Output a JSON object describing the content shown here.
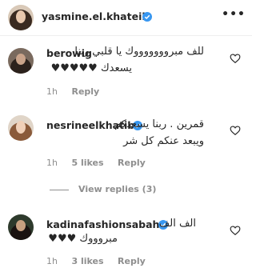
{
  "header": {
    "username": "yasmine.el.khateib",
    "verified": true
  },
  "comments": [
    {
      "username": "berowig",
      "verified": false,
      "text_line1": "للف مبروووووووك يا قلبي ربنا",
      "text_line2": "يسعدك ♥♥♥♥♥",
      "time": "1h",
      "likes": "",
      "reply": "Reply"
    },
    {
      "username": "nesrineelkhatib",
      "verified": true,
      "text_line1": "قمرين . ربنا يسعدكم",
      "text_line2": "ويبعد عنكم كل شر",
      "time": "1h",
      "likes": "5 likes",
      "reply": "Reply",
      "view_replies": "View replies (3)"
    },
    {
      "username": "kadinafashionsabah",
      "verified": true,
      "text_line1": "الف الف",
      "text_line2": "مبروووك ♥♥♥",
      "time": "1h",
      "likes": "3 likes",
      "reply": "Reply"
    }
  ],
  "icons": {
    "verified_color": "#3897f0",
    "heart": "heart-outline-icon",
    "more": "more-dots-icon"
  }
}
